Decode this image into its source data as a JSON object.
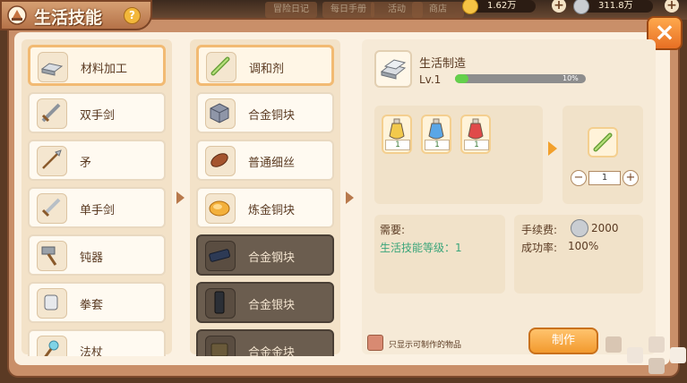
{
  "header": {
    "tabs": [
      "冒险日记",
      "每日手册",
      "活动",
      "商店"
    ],
    "currency": [
      {
        "value": "1.62万",
        "icon": "gold-coin-icon",
        "color": "#f6c344"
      },
      {
        "value": "311.8万",
        "icon": "silver-coin-icon",
        "color": "#c9cdd2"
      }
    ]
  },
  "title": {
    "text": "生活技能",
    "help": "?"
  },
  "close": "×",
  "categories": [
    {
      "label": "材料加工",
      "icon": "ingot-icon",
      "selected": true
    },
    {
      "label": "双手剑",
      "icon": "greatsword-icon"
    },
    {
      "label": "矛",
      "icon": "spear-icon"
    },
    {
      "label": "单手剑",
      "icon": "sword-icon"
    },
    {
      "label": "钝器",
      "icon": "hammer-icon"
    },
    {
      "label": "拳套",
      "icon": "gauntlet-icon"
    },
    {
      "label": "法杖",
      "icon": "staff-icon"
    }
  ],
  "recipes": [
    {
      "label": "调和剂",
      "icon": "stick-icon",
      "selected": true,
      "locked": false
    },
    {
      "label": "合金铜块",
      "icon": "cube-icon",
      "locked": false
    },
    {
      "label": "普通细丝",
      "icon": "thread-icon",
      "locked": false
    },
    {
      "label": "炼金铜块",
      "icon": "gold-nugget-icon",
      "locked": false
    },
    {
      "label": "合金钢块",
      "icon": "steel-bar-icon",
      "locked": true
    },
    {
      "label": "合金银块",
      "icon": "silver-bar-icon",
      "locked": true
    },
    {
      "label": "合金金块",
      "icon": "gold-bar-icon",
      "locked": true
    }
  ],
  "skill": {
    "name": "生活制造",
    "level": "Lv.1",
    "progress_text": "10%",
    "progress": 0.1
  },
  "materials": [
    {
      "count": "1",
      "icon": "yellow-potion-icon",
      "color": "#f2c94c"
    },
    {
      "count": "1",
      "icon": "blue-potion-icon",
      "color": "#5aa6e6"
    },
    {
      "count": "1",
      "icon": "red-potion-icon",
      "color": "#e04a4a"
    }
  ],
  "output": {
    "icon": "stick-icon",
    "quantity": "1",
    "minus": "−",
    "plus": "+"
  },
  "requirements": {
    "heading": "需要:",
    "line": "生活技能等级：1"
  },
  "fee": {
    "label": "手续费:",
    "value": "2000",
    "rate_label": "成功率:",
    "rate": "100%"
  },
  "filter_label": "只显示可制作的物品",
  "craft_button": "制作"
}
